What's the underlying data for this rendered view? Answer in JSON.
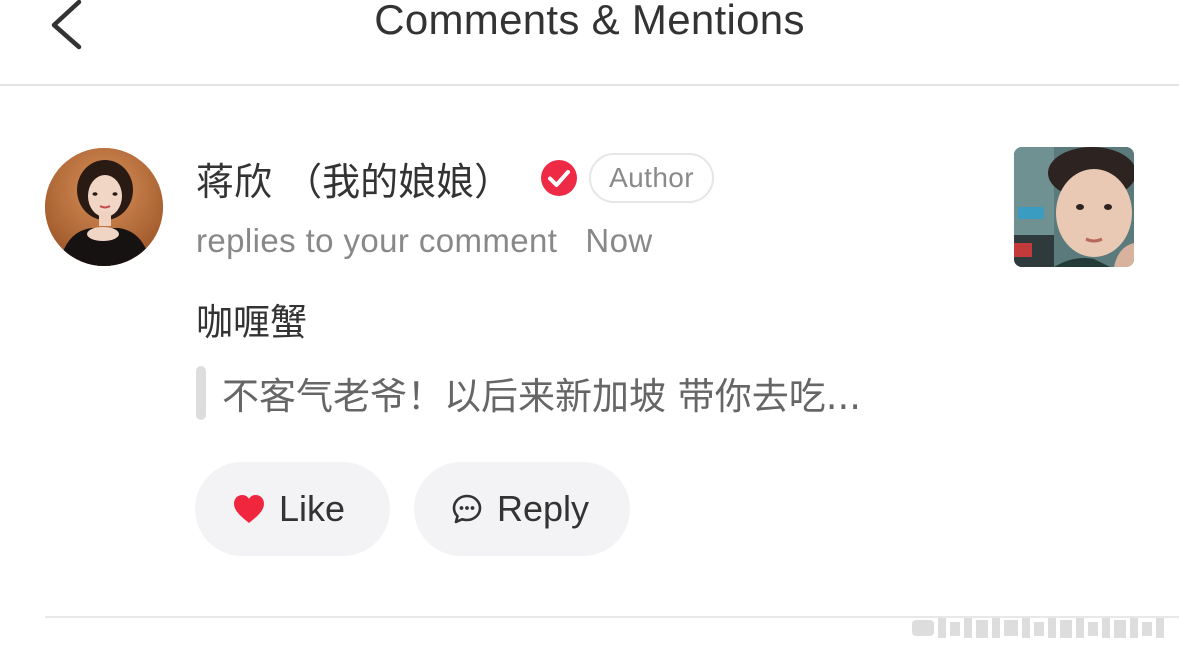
{
  "header": {
    "title": "Comments & Mentions",
    "back_icon": "chevron-left-icon"
  },
  "notification": {
    "user_name": "蒋欣 （我的娘娘）",
    "verified_icon": "verified-check-icon",
    "verified_color": "#ee2a44",
    "author_badge": "Author",
    "action_text": "replies to your comment",
    "time": "Now",
    "comment": "咖喱蟹",
    "quoted_comment": "不客气老爷！以后来新加坡 带你去吃...",
    "like_label": "Like",
    "like_icon": "heart-icon",
    "like_color": "#f0263f",
    "reply_label": "Reply",
    "reply_icon": "chat-bubble-icon"
  }
}
